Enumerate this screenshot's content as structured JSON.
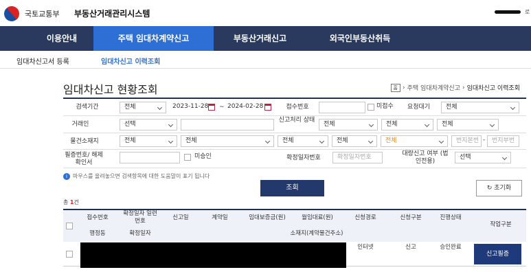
{
  "header": {
    "ministry": "국토교통부",
    "system_title": "부동산거래관리시스템",
    "logout": "로"
  },
  "nav": [
    "이용안내",
    "주택 임대차계약신고",
    "부동산거래신고",
    "외국인부동산취득"
  ],
  "subnav": [
    "임대차신고서 등록",
    "임대차신고 이력조회"
  ],
  "page": {
    "title": "임대차신고 현황조회",
    "breadcrumb_home": "홈",
    "breadcrumb_parent": "주택 임대차계약신고",
    "breadcrumb_current": "임대차신고 이력조회"
  },
  "form": {
    "period_label": "검색기간",
    "period_select": "전체",
    "date_from": "2023-11-28",
    "date_sep": "~",
    "date_to": "2024-02-28",
    "receipt_label": "접수번호",
    "unreceived_label": "미접수",
    "request_label": "요청대기",
    "request_select": "전체",
    "party_label": "거래인",
    "party_select": "선택",
    "status_label": "신고처리 상태",
    "status_select1": "전체",
    "status_select2": "전체",
    "status_select3": "전체",
    "property_label": "물건소재지",
    "prop_select1": "전체",
    "prop_select2": "전체",
    "prop_select3": "전체",
    "prop_select4": "전체",
    "prop_select5": "전체",
    "lot_main_placeholder": "번지본번",
    "lot_dash": "-",
    "lot_sub_placeholder": "번지부번",
    "cert_label": "필증번호/ 해제확인서",
    "unapproved_label": "미승인",
    "confirm_label": "확정일자번호",
    "confirm_placeholder": "확정일자번호",
    "bulk_label": "대량신고 여부 (법인전용)",
    "bulk_select": "선택"
  },
  "info_text": "마우스를 올려놓으면 검색항목에 대한 도움말이 표기 됩니다",
  "buttons": {
    "search": "조회",
    "reset": "초기화",
    "request": "신고필증"
  },
  "result": {
    "prefix": "총",
    "count": "1",
    "suffix": "건"
  },
  "table": {
    "headers": [
      "접수번호",
      "확정일자 일련번호",
      "신고일",
      "계약일",
      "임대보증금(원)",
      "월임대료(원)",
      "신청경로",
      "신청구분",
      "진행상태",
      "작업구분"
    ],
    "headers_row2": [
      "행정동",
      "확정일자",
      "소재지(계약물건주소)"
    ],
    "row": {
      "channel": "인터넷",
      "type": "신고",
      "status": "승인완료"
    }
  }
}
